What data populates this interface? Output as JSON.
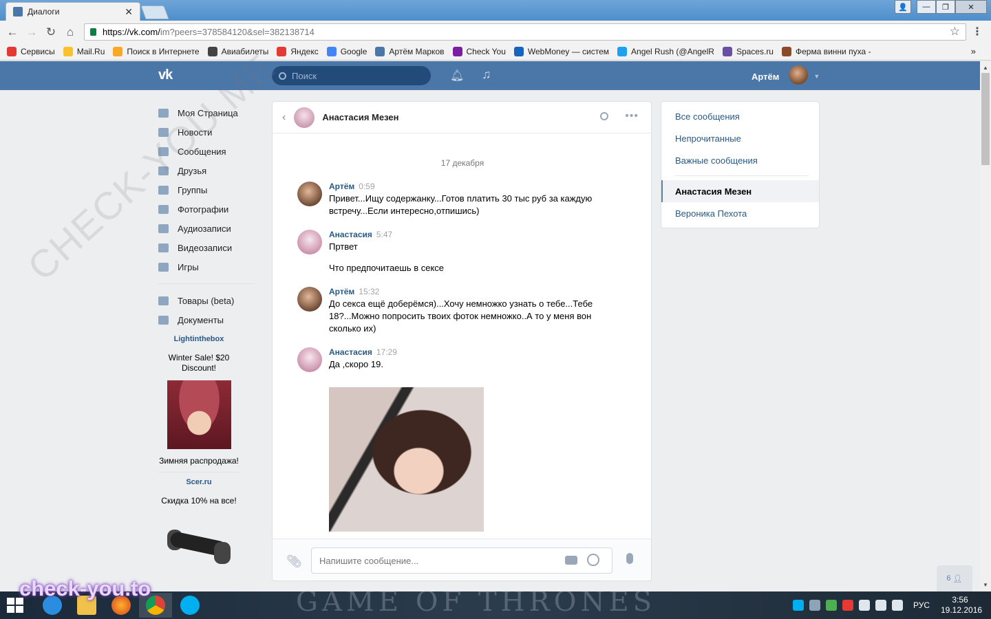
{
  "browser": {
    "tab_title": "Диалоги",
    "url_host": "https://vk.com/",
    "url_path": "im?peers=378584120&sel=382138714",
    "bookmarks": [
      {
        "label": "Сервисы",
        "color": "#e53935"
      },
      {
        "label": "Mail.Ru",
        "color": "#fbc02d"
      },
      {
        "label": "Поиск в Интернете",
        "color": "#f9a825"
      },
      {
        "label": "Авиабилеты",
        "color": "#444444"
      },
      {
        "label": "Яндекс",
        "color": "#e53935"
      },
      {
        "label": "Google",
        "color": "#4285f4"
      },
      {
        "label": "Артём Марков",
        "color": "#4a76a8"
      },
      {
        "label": "Check You",
        "color": "#7b1fa2"
      },
      {
        "label": "WebMoney — систем",
        "color": "#1565c0"
      },
      {
        "label": "Angel Rush (@AngelR",
        "color": "#1da1f2"
      },
      {
        "label": "Spaces.ru",
        "color": "#6a4fa3"
      },
      {
        "label": "Ферма винни пуха -",
        "color": "#8d4a2b"
      }
    ],
    "bookmarks_more": "»"
  },
  "vk": {
    "logo": "vk",
    "search_placeholder": "Поиск",
    "user_name": "Артём"
  },
  "left_menu": {
    "items": [
      {
        "label": "Моя Страница",
        "icon": "home-icon"
      },
      {
        "label": "Новости",
        "icon": "news-icon"
      },
      {
        "label": "Сообщения",
        "icon": "messages-icon"
      },
      {
        "label": "Друзья",
        "icon": "friends-icon"
      },
      {
        "label": "Группы",
        "icon": "groups-icon"
      },
      {
        "label": "Фотографии",
        "icon": "photos-icon"
      },
      {
        "label": "Аудиозаписи",
        "icon": "audio-icon"
      },
      {
        "label": "Видеозаписи",
        "icon": "video-icon"
      },
      {
        "label": "Игры",
        "icon": "games-icon"
      }
    ],
    "extra": [
      {
        "label": "Товары (beta)",
        "icon": "goods-icon"
      },
      {
        "label": "Документы",
        "icon": "documents-icon"
      }
    ],
    "ads": [
      {
        "title": "Lightinthebox",
        "subtitle": "Winter Sale! $20 Discount!",
        "caption": "Зимняя распродажа!"
      },
      {
        "title": "Scer.ru",
        "subtitle": "Скидка 10% на все!"
      }
    ]
  },
  "chat": {
    "peer_name": "Анастасия Мезен",
    "date": "17 декабря",
    "messages": [
      {
        "author": "Артём",
        "time": "0:59",
        "text": "Привет...Ищу содержанку...Готов платить 30 тыс руб за каждую встречу...Если интересно,отпишись)"
      },
      {
        "author": "Анастасия",
        "time": "5:47",
        "text": "Пртвет",
        "text2": "Что предпочитаешь в сексе"
      },
      {
        "author": "Артём",
        "time": "15:32",
        "text": "До секса ещё доберёмся)...Хочу немножко узнать о тебе...Тебе 18?...Можно попросить твоих фоток немножко..А то у меня вон сколько их)"
      },
      {
        "author": "Анастасия",
        "time": "17:29",
        "text": "Да ,скоро 19."
      }
    ],
    "composer_placeholder": "Напишите сообщение..."
  },
  "right_menu": {
    "filters": [
      "Все сообщения",
      "Непрочитанные",
      "Важные сообщения"
    ],
    "dialogs": [
      "Анастасия Мезен",
      "Вероника Пехота"
    ]
  },
  "online_count": "6",
  "taskbar": {
    "background_text": "GAME OF THRONES",
    "lang": "РУС",
    "time": "3:56",
    "date": "19.12.2016"
  },
  "watermark": {
    "diagonal": "CHECK-YOU.ME",
    "bottom": "check-you.to"
  }
}
